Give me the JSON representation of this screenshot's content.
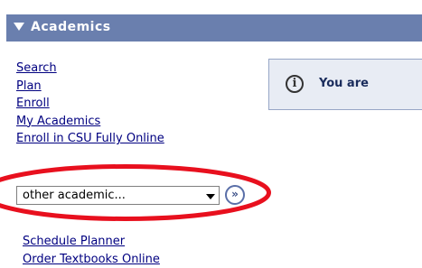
{
  "header": {
    "title": "Academics",
    "color": "#6a7fae"
  },
  "links": [
    {
      "label": "Search"
    },
    {
      "label": "Plan"
    },
    {
      "label": "Enroll"
    },
    {
      "label": "My Academics"
    },
    {
      "label": "Enroll in CSU Fully Online"
    }
  ],
  "notice": {
    "icon": "info-icon",
    "icon_glyph": "i",
    "message": "You are"
  },
  "select": {
    "value": "other academic..."
  },
  "go_button": {
    "icon": "double-chevron-right-icon",
    "glyph": "»"
  },
  "highlight": {
    "color": "#e8101e"
  },
  "bottom_links": [
    {
      "label": "Schedule Planner"
    },
    {
      "label": "Order Textbooks Online"
    }
  ]
}
